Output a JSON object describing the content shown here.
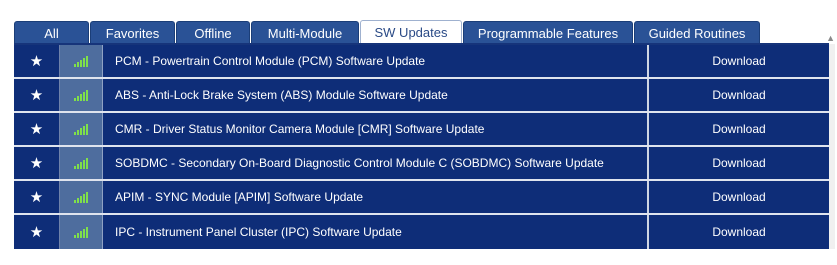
{
  "tabs": [
    {
      "label": "All",
      "active": false
    },
    {
      "label": "Favorites",
      "active": false
    },
    {
      "label": "Offline",
      "active": false
    },
    {
      "label": "Multi-Module",
      "active": false
    },
    {
      "label": "SW Updates",
      "active": true
    },
    {
      "label": "Programmable Features",
      "active": false
    },
    {
      "label": "Guided Routines",
      "active": false
    }
  ],
  "rows": [
    {
      "name": "PCM - Powertrain Control Module (PCM) Software Update",
      "action": "Download",
      "fav_icon": "star-icon",
      "signal_icon": "signal-bars-icon"
    },
    {
      "name": "ABS - Anti-Lock Brake System (ABS) Module Software Update",
      "action": "Download",
      "fav_icon": "star-icon",
      "signal_icon": "signal-bars-icon"
    },
    {
      "name": "CMR - Driver Status Monitor Camera Module [CMR] Software Update",
      "action": "Download",
      "fav_icon": "star-icon",
      "signal_icon": "signal-bars-icon"
    },
    {
      "name": "SOBDMC - Secondary On-Board Diagnostic Control Module C (SOBDMC) Software Update",
      "action": "Download",
      "fav_icon": "star-icon",
      "signal_icon": "signal-bars-icon"
    },
    {
      "name": "APIM - SYNC Module [APIM] Software Update",
      "action": "Download",
      "fav_icon": "star-icon",
      "signal_icon": "signal-bars-icon"
    },
    {
      "name": "IPC - Instrument Panel Cluster (IPC) Software Update",
      "action": "Download",
      "fav_icon": "star-icon",
      "signal_icon": "signal-bars-icon"
    }
  ],
  "colors": {
    "tab_bg": "#2a5296",
    "row_bg": "#0e2d78",
    "signal_cell_bg": "#4e6d9e",
    "signal_bars": "#7fe04a"
  }
}
